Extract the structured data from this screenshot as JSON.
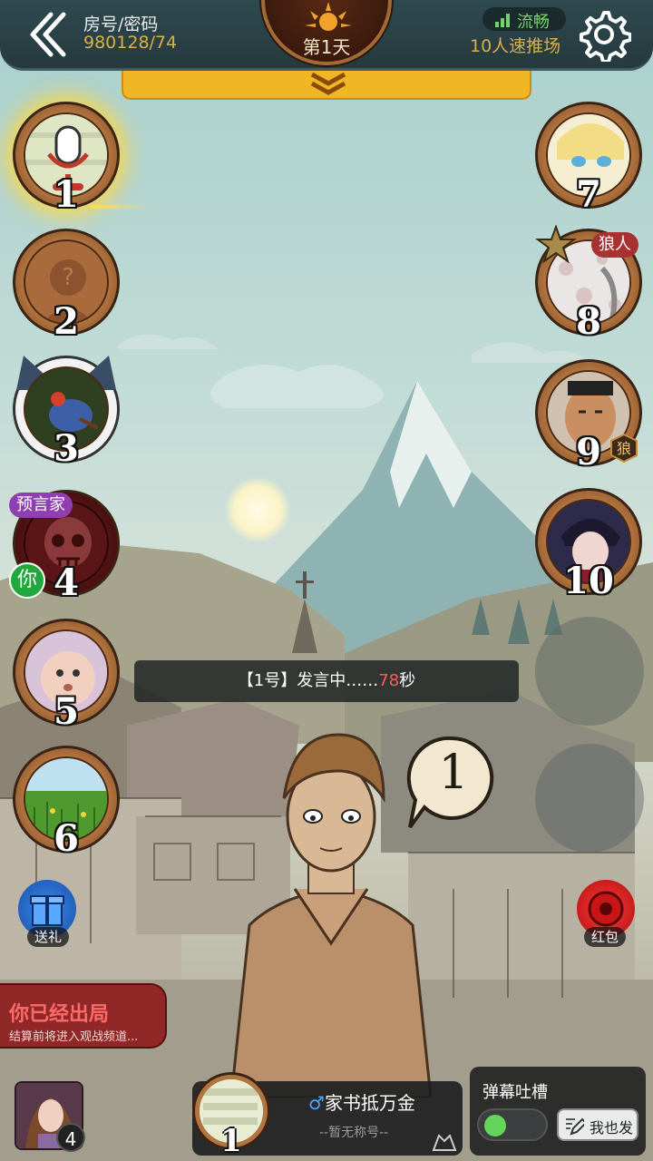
{
  "header": {
    "room_label": "房号/密码",
    "room_value": "980128/74",
    "day": "第1天",
    "network": "流畅",
    "mode": "10人速推场"
  },
  "seats": [
    {
      "number": "1"
    },
    {
      "number": "2"
    },
    {
      "number": "3"
    },
    {
      "number": "4",
      "role_tag": "预言家",
      "you_label": "你"
    },
    {
      "number": "5"
    },
    {
      "number": "6"
    },
    {
      "number": "7"
    },
    {
      "number": "8",
      "role_tag": "狼人"
    },
    {
      "number": "9",
      "badge": "狼"
    },
    {
      "number": "10"
    }
  ],
  "status": {
    "prefix": "【1号】发言中……",
    "seconds": "78",
    "suffix": "秒"
  },
  "speech_bubble_number": "1",
  "side_buttons": {
    "gift": "送礼",
    "red_packet": "红包"
  },
  "out_banner": {
    "title": "你已经出局",
    "subtitle": "结算前将进入观战频道..."
  },
  "bottom": {
    "my_seat": "4",
    "speaker_seat": "1",
    "speaker_gender_symbol": "♂",
    "speaker_name": "家书抵万金",
    "speaker_title": "--暂无称号--",
    "danmaku_title": "弹幕吐槽",
    "send_label": "我也发"
  },
  "colors": {
    "gold": "#d9b04a",
    "accent_yellow": "#f0b623",
    "status_seconds": "#ff5a5a",
    "network_green": "#73d36c",
    "out_red": "#ff6b6b"
  }
}
